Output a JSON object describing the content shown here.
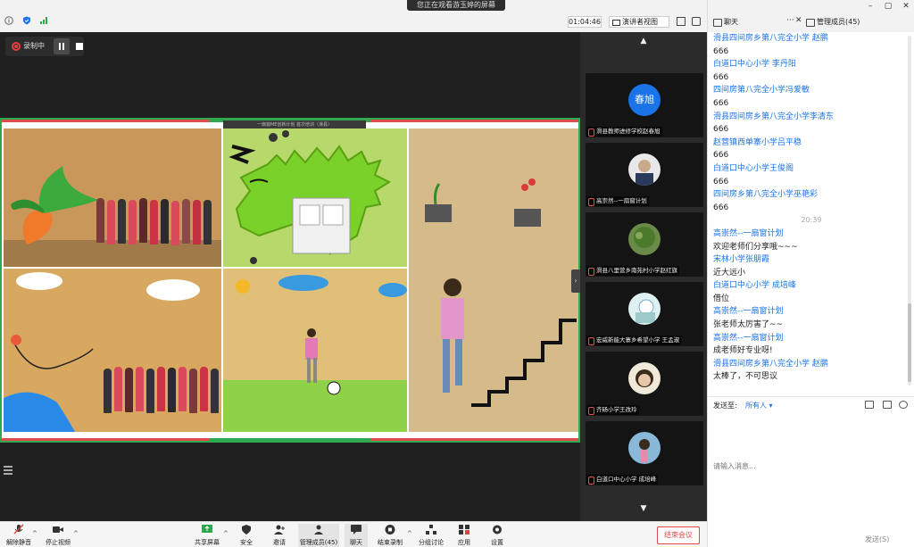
{
  "window": {
    "viewing_banner": "您正在观看游玉婷的屏幕",
    "timer": "01:04:46",
    "view_mode": "演讲者视图"
  },
  "recording": {
    "label": "录制中"
  },
  "shared_screen": {
    "label": "一扇窗ME创新计划 首次培训（滑县）"
  },
  "participants_strip": [
    {
      "avatar_text": "春旭",
      "name": "滑县教师进修学校赵春旭"
    },
    {
      "avatar_text": "",
      "name": "高崇然--一扇窗计划"
    },
    {
      "avatar_text": "",
      "name": "滑县八里营乡南苑村小学赵红旗"
    },
    {
      "avatar_text": "",
      "name": "宏威新能大寨乡希望小学 王孟淑"
    },
    {
      "avatar_text": "",
      "name": "齐砀小学王改玲"
    },
    {
      "avatar_text": "",
      "name": "白道口中心小学 成培峰"
    }
  ],
  "toolbar": {
    "mute": "解除静音",
    "stop_video": "停止视频",
    "share": "共享屏幕",
    "security": "安全",
    "invite": "邀请",
    "members": "管理成员(45)",
    "chat": "聊天",
    "end_record": "结束录制",
    "breakout": "分组讨论",
    "apps": "应用",
    "settings": "设置",
    "end_meeting": "结束会议"
  },
  "chat": {
    "tab_chat": "聊天",
    "tab_members": "管理成员(45)",
    "messages": [
      {
        "type": "name",
        "text": "滑县四间房乡第八完全小学 赵鹏"
      },
      {
        "type": "text",
        "text": "666"
      },
      {
        "type": "name",
        "text": "白道口中心小学 李丹阳"
      },
      {
        "type": "text",
        "text": "666"
      },
      {
        "type": "name",
        "text": "四间房第八完全小学冯爱敏"
      },
      {
        "type": "text",
        "text": "666"
      },
      {
        "type": "name",
        "text": "滑县四间房乡第八完全小学李清东"
      },
      {
        "type": "text",
        "text": "666"
      },
      {
        "type": "name",
        "text": "赵营镇西单寨小学吕平稳"
      },
      {
        "type": "text",
        "text": "666"
      },
      {
        "type": "name",
        "text": "白道口中心小学王俊阁"
      },
      {
        "type": "text",
        "text": "666"
      },
      {
        "type": "name",
        "text": "四间房乡第八完全小学巫艳彩"
      },
      {
        "type": "text",
        "text": "666"
      },
      {
        "type": "time",
        "text": "20:39"
      },
      {
        "type": "name",
        "text": "高崇然--一扇窗计划"
      },
      {
        "type": "text",
        "text": "欢迎老师们分享哦~~~"
      },
      {
        "type": "name",
        "text": "宋林小学张朋霞"
      },
      {
        "type": "text",
        "text": "近大远小"
      },
      {
        "type": "name",
        "text": "白道口中心小学 成培峰"
      },
      {
        "type": "text",
        "text": "借位"
      },
      {
        "type": "name",
        "text": "高崇然--一扇窗计划"
      },
      {
        "type": "text",
        "text": "张老师太厉害了~~"
      },
      {
        "type": "name",
        "text": "高崇然--一扇窗计划"
      },
      {
        "type": "text",
        "text": "成老师好专业呀!"
      },
      {
        "type": "name",
        "text": "滑县四间房乡第八完全小学 赵鹏"
      },
      {
        "type": "text",
        "text": "太棒了，不可思议"
      }
    ],
    "send_to_label": "发送至:",
    "send_to_target": "所有人",
    "input_placeholder": "请输入消息...",
    "send_button": "发送(S)"
  }
}
